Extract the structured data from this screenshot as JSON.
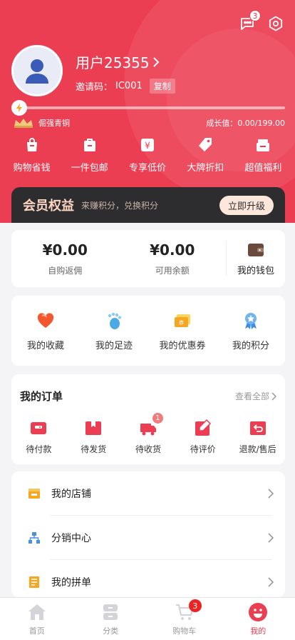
{
  "header": {
    "message_badge": "3",
    "user_name": "用户25355",
    "invite_label": "邀请码：",
    "invite_code": "IC001",
    "copy_label": "复制",
    "level_name": "倔强青铜",
    "growth_label": "成长值：",
    "growth_value": "0.00/199.00",
    "progress_fraction": 0.0
  },
  "perks": [
    {
      "label": "购物省钱",
      "icon": "bag-icon"
    },
    {
      "label": "一件包邮",
      "icon": "bag-icon"
    },
    {
      "label": "专享低价",
      "icon": "yen-tag-icon"
    },
    {
      "label": "大牌折扣",
      "icon": "tag-icon"
    },
    {
      "label": "超值福利",
      "icon": "gift-box-icon"
    }
  ],
  "member": {
    "title": "会员权益",
    "subtitle": "来赚积分，兑换积分",
    "upgrade_label": "立即升级"
  },
  "wallet": {
    "self_purchase_amount": "¥0.00",
    "self_purchase_label": "自购返佣",
    "balance_amount": "¥0.00",
    "balance_label": "可用余额",
    "wallet_label": "我的钱包"
  },
  "quick": [
    {
      "label": "我的收藏",
      "icon": "heart-icon"
    },
    {
      "label": "我的足迹",
      "icon": "footprint-icon"
    },
    {
      "label": "我的优惠券",
      "icon": "coupon-icon"
    },
    {
      "label": "我的积分",
      "icon": "badge-ribbon-icon"
    }
  ],
  "orders": {
    "title": "我的订单",
    "view_all": "查看全部",
    "items": [
      {
        "label": "待付款",
        "icon": "wallet-card-icon"
      },
      {
        "label": "待发货",
        "icon": "package-icon"
      },
      {
        "label": "待收货",
        "icon": "truck-icon",
        "badge": "1"
      },
      {
        "label": "待评价",
        "icon": "pen-icon"
      },
      {
        "label": "退款/售后",
        "icon": "return-icon"
      }
    ]
  },
  "menu": [
    {
      "label": "我的店铺",
      "icon": "store-icon"
    },
    {
      "label": "分销中心",
      "icon": "network-icon"
    },
    {
      "label": "我的拼单",
      "icon": "notebook-icon"
    }
  ],
  "tabbar": [
    {
      "label": "首页",
      "icon": "home-icon"
    },
    {
      "label": "分类",
      "icon": "category-icon"
    },
    {
      "label": "购物车",
      "icon": "cart-icon",
      "badge": "3"
    },
    {
      "label": "我的",
      "icon": "smiley-icon",
      "active": true
    }
  ],
  "colors": {
    "brand_red": "#ec3e52",
    "member_dark": "#2d2d30",
    "member_gold": "#fcd4c0"
  }
}
